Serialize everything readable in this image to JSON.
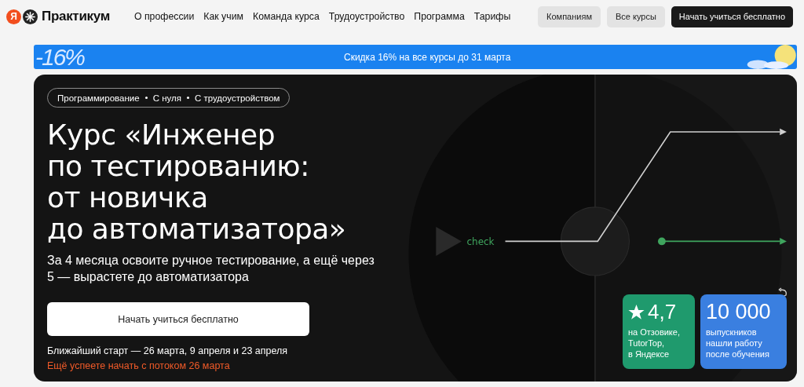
{
  "header": {
    "logo": {
      "badge": "Я",
      "name": "Практикум"
    },
    "nav": [
      "О профессии",
      "Как учим",
      "Команда курса",
      "Трудоустройство",
      "Программа",
      "Тарифы"
    ],
    "buttons": [
      {
        "label": "Компаниям",
        "kind": "secondary"
      },
      {
        "label": "Все курсы",
        "kind": "secondary"
      },
      {
        "label": "Начать учиться бесплатно",
        "kind": "primary"
      }
    ]
  },
  "promo_banner": {
    "discount": "-16%",
    "text": "Скидка 16% на все курсы до 31 марта"
  },
  "hero": {
    "tags": [
      "Программирование",
      "С нуля",
      "С трудоустройством"
    ],
    "title_lines": [
      "Курс «Инженер",
      "по тестированию:",
      "от новичка",
      "до автоматизатора»"
    ],
    "subtitle_lines": [
      "За 4 месяца освоите ручное тестирование, а ещё через",
      "5 — вырастете до автоматизатора"
    ],
    "cta": "Начать учиться бесплатно",
    "start_dates": "Ближайший старт — 26 марта, 9 апреля и 23 апреля",
    "urgency": "Ещё успеете начать с потоком 26 марта",
    "illustration": {
      "label": "check"
    },
    "stats": [
      {
        "kind": "rating",
        "value": "4,7",
        "caption_lines": [
          "на Отзовике,",
          "TutorTop,",
          "в Яндексе"
        ],
        "color": "#1f9a6d"
      },
      {
        "kind": "count",
        "value": "10 000",
        "caption_lines": [
          "выпускников",
          "нашли работу",
          "после обучения"
        ],
        "color": "#3a7fe0"
      }
    ]
  }
}
